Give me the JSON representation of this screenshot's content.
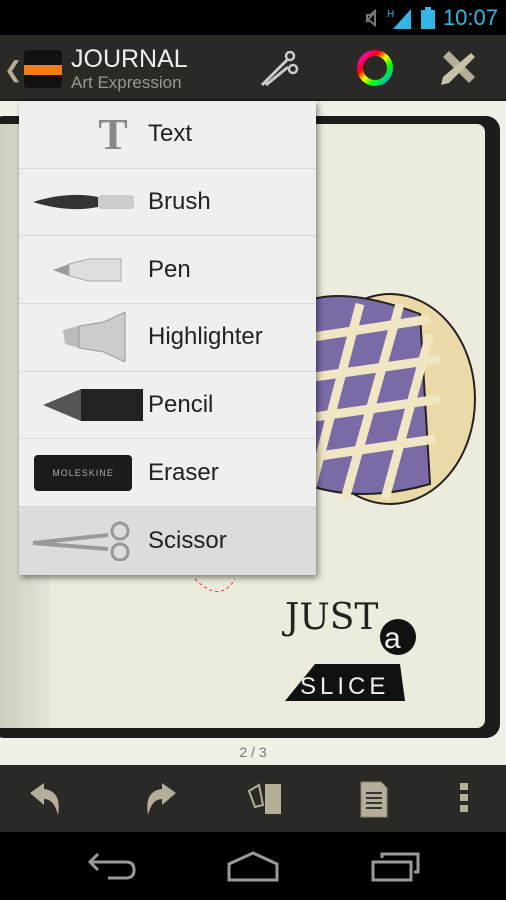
{
  "status_bar": {
    "time": "10:07",
    "network": "H",
    "icons": [
      "mute-icon",
      "signal-icon",
      "battery-icon"
    ]
  },
  "action_bar": {
    "title": "JOURNAL",
    "subtitle": "Art Expression",
    "actions": [
      "scissor-icon",
      "color-wheel-icon",
      "tools-icon"
    ]
  },
  "tool_menu": {
    "items": [
      {
        "label": "Text",
        "icon": "text-tool-icon",
        "selected": false
      },
      {
        "label": "Brush",
        "icon": "brush-icon",
        "selected": false
      },
      {
        "label": "Pen",
        "icon": "pen-icon",
        "selected": false
      },
      {
        "label": "Highlighter",
        "icon": "highlighter-icon",
        "selected": false
      },
      {
        "label": "Pencil",
        "icon": "pencil-icon",
        "selected": false
      },
      {
        "label": "Eraser",
        "icon": "eraser-icon",
        "selected": false,
        "icon_text": "MOLESKINE"
      },
      {
        "label": "Scissor",
        "icon": "scissor-icon",
        "selected": true
      }
    ]
  },
  "canvas": {
    "lettering": [
      "JUST",
      "a",
      "SLICE"
    ]
  },
  "page_indicator": "2 / 3",
  "bottom_toolbar": [
    "undo-icon",
    "redo-icon",
    "page-layout-icon",
    "page-list-icon",
    "overflow-menu-icon"
  ],
  "nav_bar": [
    "back-icon",
    "home-icon",
    "recent-apps-icon"
  ],
  "colors": {
    "accent": "#33b5e5",
    "toolbar": "#2b2926",
    "menu": "#efefef",
    "selected": "#dcdcdc",
    "page": "#ecebdd"
  }
}
